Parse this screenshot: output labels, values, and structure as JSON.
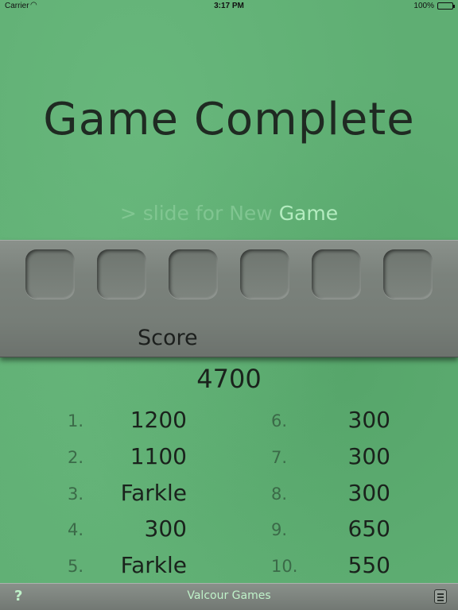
{
  "status_bar": {
    "carrier": "Carrier",
    "time": "3:17 PM",
    "battery_percent": "100%",
    "battery_level": 1.0
  },
  "title": "Game Complete",
  "slide_hint": {
    "prefix": "> slide for New ",
    "highlight": "Game"
  },
  "tray": {
    "dice_slots": 6,
    "score_label": "Score"
  },
  "total_score": "4700",
  "rounds": [
    {
      "num": "1.",
      "score": "1200"
    },
    {
      "num": "2.",
      "score": "1100"
    },
    {
      "num": "3.",
      "score": "Farkle"
    },
    {
      "num": "4.",
      "score": "300"
    },
    {
      "num": "5.",
      "score": "Farkle"
    },
    {
      "num": "6.",
      "score": "300"
    },
    {
      "num": "7.",
      "score": "300"
    },
    {
      "num": "8.",
      "score": "300"
    },
    {
      "num": "9.",
      "score": "650"
    },
    {
      "num": "10.",
      "score": "550"
    }
  ],
  "bottom_bar": {
    "help": "?",
    "brand": "Valcour Games",
    "menu_icon": "notes-icon"
  }
}
